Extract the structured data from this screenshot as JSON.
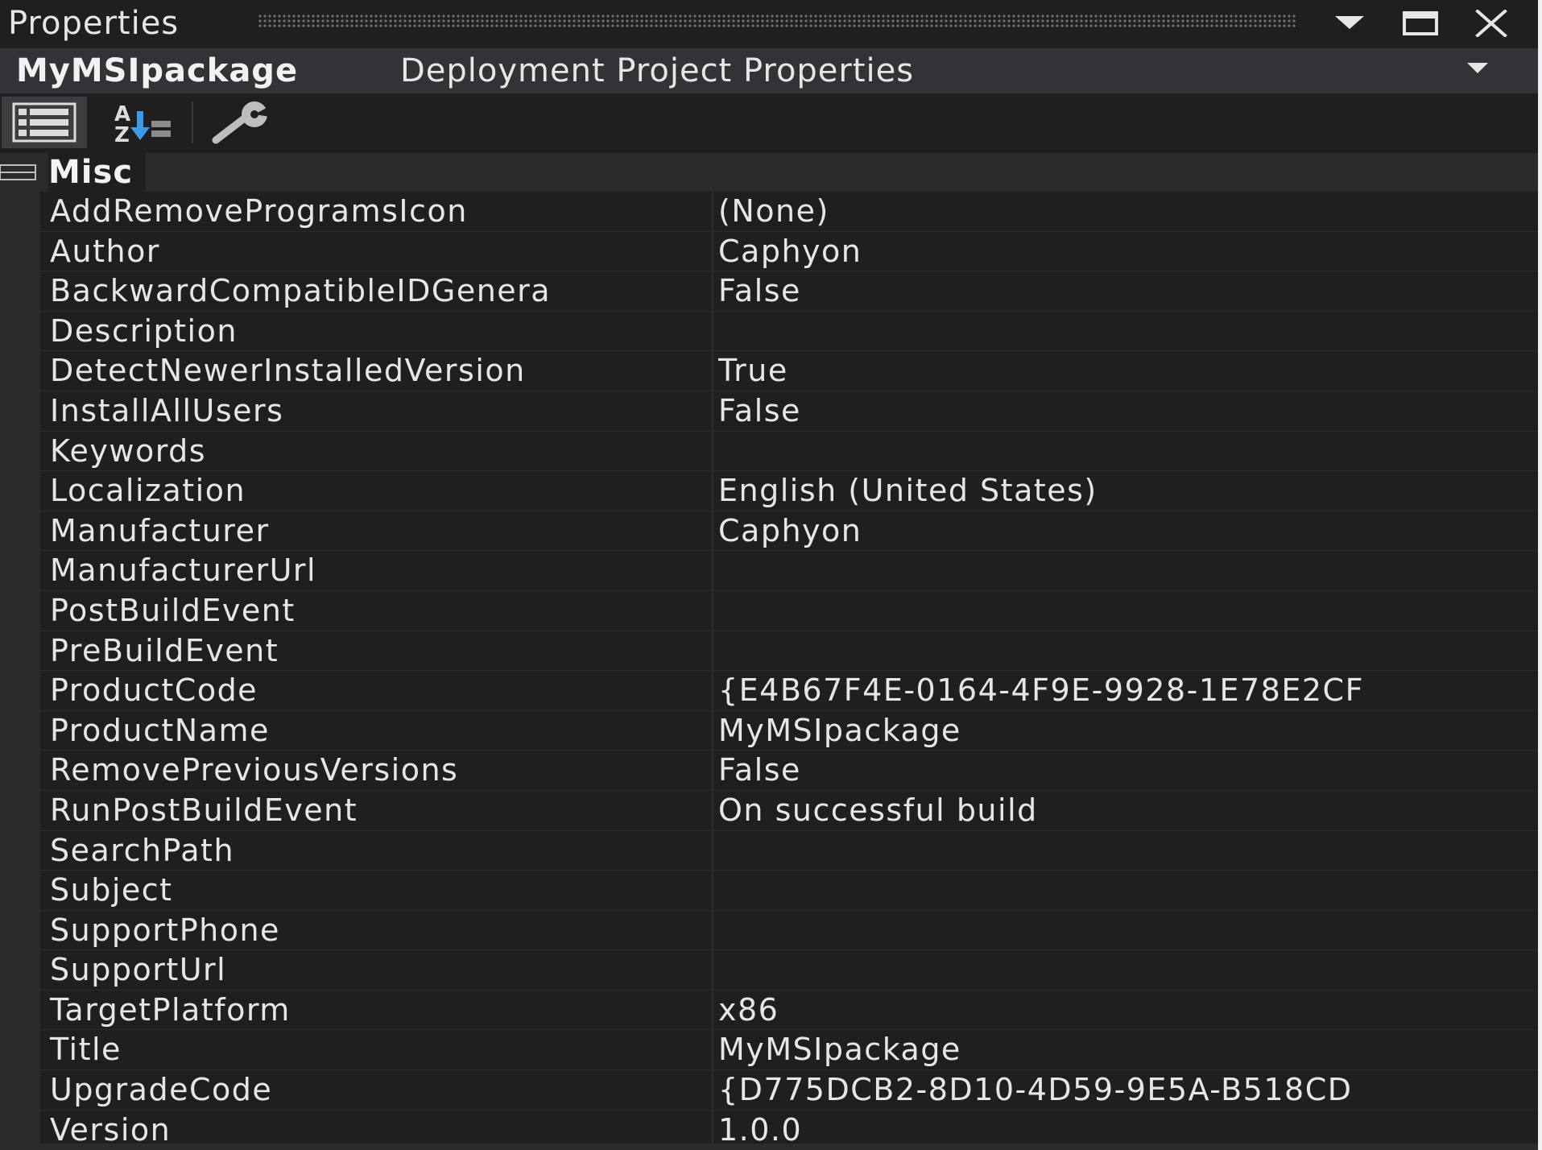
{
  "window": {
    "title": "Properties",
    "buttons": {
      "dropdown": "chevron-down-icon",
      "maximize": "maximize-icon",
      "close": "close-icon"
    }
  },
  "object_selector": {
    "name": "MyMSIpackage",
    "type": "Deployment Project Properties"
  },
  "toolbar": {
    "buttons": [
      {
        "icon": "categorized-icon",
        "active": true
      },
      {
        "icon": "alphabetical-sort-icon",
        "active": false
      },
      {
        "icon": "property-pages-wrench-icon",
        "active": false
      }
    ]
  },
  "category": {
    "label": "Misc",
    "expanded": true
  },
  "properties": [
    {
      "name": "AddRemoveProgramsIcon",
      "value": "(None)"
    },
    {
      "name": "Author",
      "value": "Caphyon"
    },
    {
      "name": "BackwardCompatibleIDGenera",
      "value": "False"
    },
    {
      "name": "Description",
      "value": ""
    },
    {
      "name": "DetectNewerInstalledVersion",
      "value": "True"
    },
    {
      "name": "InstallAllUsers",
      "value": "False"
    },
    {
      "name": "Keywords",
      "value": ""
    },
    {
      "name": "Localization",
      "value": "English (United States)"
    },
    {
      "name": "Manufacturer",
      "value": "Caphyon"
    },
    {
      "name": "ManufacturerUrl",
      "value": ""
    },
    {
      "name": "PostBuildEvent",
      "value": ""
    },
    {
      "name": "PreBuildEvent",
      "value": ""
    },
    {
      "name": "ProductCode",
      "value": "{E4B67F4E-0164-4F9E-9928-1E78E2CF"
    },
    {
      "name": "ProductName",
      "value": "MyMSIpackage"
    },
    {
      "name": "RemovePreviousVersions",
      "value": "False"
    },
    {
      "name": "RunPostBuildEvent",
      "value": "On successful build"
    },
    {
      "name": "SearchPath",
      "value": ""
    },
    {
      "name": "Subject",
      "value": ""
    },
    {
      "name": "SupportPhone",
      "value": ""
    },
    {
      "name": "SupportUrl",
      "value": ""
    },
    {
      "name": "TargetPlatform",
      "value": "x86"
    },
    {
      "name": "Title",
      "value": "MyMSIpackage"
    },
    {
      "name": "UpgradeCode",
      "value": "{D775DCB2-8D10-4D59-9E5A-B518CD"
    },
    {
      "name": "Version",
      "value": "1.0.0"
    }
  ],
  "colors": {
    "panel_bg": "#1f1f1f",
    "header_bg": "#333337",
    "category_bg": "#2b2b2b",
    "text": "#e6e6e6",
    "accent_blue": "#3c9ae8"
  }
}
